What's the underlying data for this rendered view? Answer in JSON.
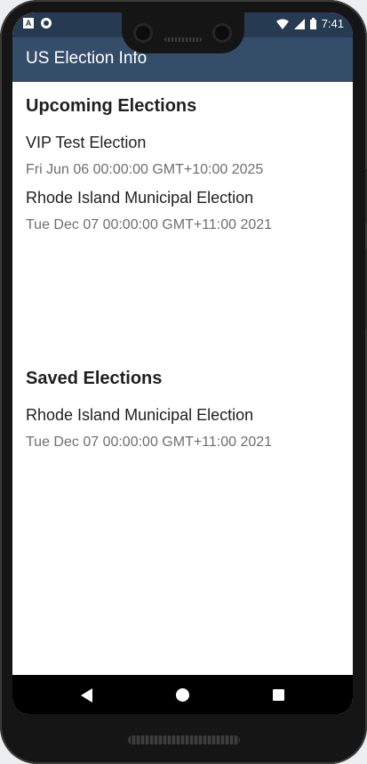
{
  "status_bar": {
    "time": "7:41",
    "left_icons": [
      "a-icon",
      "circle-icon"
    ],
    "right_icons": [
      "wifi-icon",
      "signal-icon",
      "battery-icon"
    ]
  },
  "app_bar": {
    "title": "US Election Info",
    "color": "#344e6a"
  },
  "upcoming": {
    "title": "Upcoming Elections",
    "items": [
      {
        "name": "VIP Test Election",
        "date": "Fri Jun 06 00:00:00 GMT+10:00 2025"
      },
      {
        "name": "Rhode Island Municipal Election",
        "date": "Tue Dec 07 00:00:00 GMT+11:00 2021"
      }
    ]
  },
  "saved": {
    "title": "Saved Elections",
    "items": [
      {
        "name": "Rhode Island Municipal Election",
        "date": "Tue Dec 07 00:00:00 GMT+11:00 2021"
      }
    ]
  },
  "nav_bar": {
    "buttons": [
      "back-icon",
      "home-icon",
      "recents-icon"
    ]
  }
}
